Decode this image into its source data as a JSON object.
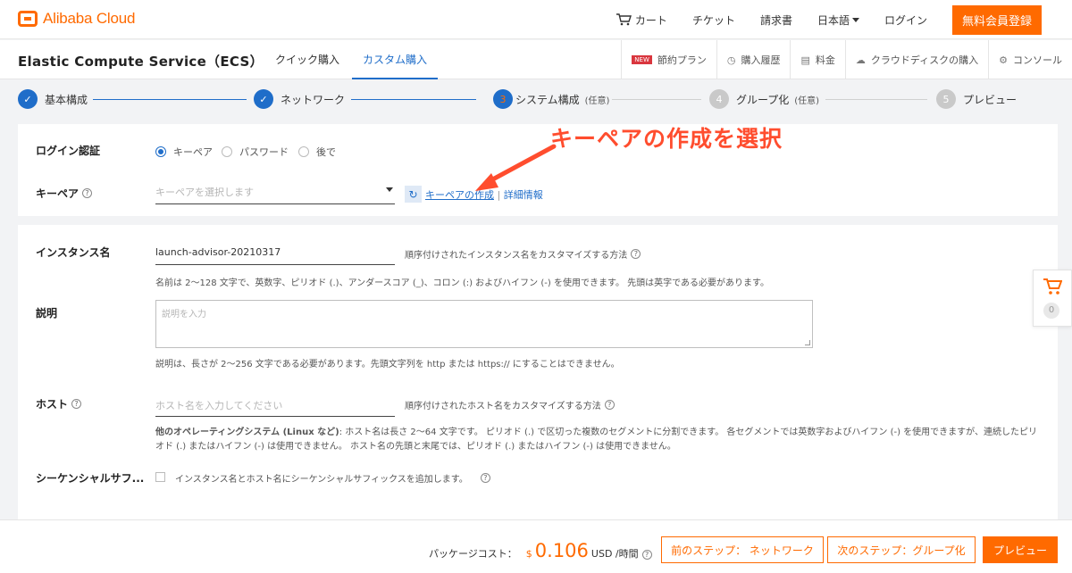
{
  "header": {
    "logo_text": "Alibaba Cloud",
    "nav": {
      "cart": "カート",
      "ticket": "チケット",
      "invoice": "請求書",
      "language": "日本語",
      "login": "ログイン"
    },
    "signup": "無料会員登録"
  },
  "product": {
    "title": "Elastic Compute Service（ECS）",
    "tabs": [
      "クイック購入",
      "カスタム購入"
    ],
    "active_tab": "カスタム購入",
    "links": {
      "new_badge": "NEW",
      "savings": "節約プラン",
      "history": "購入履歴",
      "pricing": "料金",
      "cloud_disk": "クラウドディスクの購入",
      "console": "コンソール"
    }
  },
  "steps": [
    {
      "num": "1",
      "label": "基本構成",
      "state": "done",
      "note": ""
    },
    {
      "num": "2",
      "label": "ネットワーク",
      "state": "done",
      "note": ""
    },
    {
      "num": "3",
      "label": "システム構成",
      "state": "current",
      "note": "(任意)"
    },
    {
      "num": "4",
      "label": "グループ化",
      "state": "todo",
      "note": "(任意)"
    },
    {
      "num": "5",
      "label": "プレビュー",
      "state": "todo",
      "note": ""
    }
  ],
  "login_section": {
    "auth_label": "ログイン認証",
    "options": [
      "キーペア",
      "パスワード",
      "後で"
    ],
    "selected": "キーペア",
    "keypair_label": "キーペア",
    "keypair_placeholder": "キーペアを選択します",
    "create_link": "キーペアの作成",
    "separator": "|",
    "details_link": "詳細情報"
  },
  "annotation": "キーペアの作成を選択",
  "instance_section": {
    "name_label": "インスタンス名",
    "name_value": "launch-advisor-20210317",
    "name_customize": "順序付けされたインスタンス名をカスタマイズする方法",
    "name_hint": "名前は 2～128 文字で、英数字、ピリオド (.)、アンダースコア (_)、コロン (:) およびハイフン (-) を使用できます。 先頭は英字である必要があります。",
    "desc_label": "説明",
    "desc_placeholder": "説明を入力",
    "desc_hint": "説明は、長さが 2～256 文字である必要があります。先頭文字列を http または https:// にすることはできません。",
    "host_label": "ホスト",
    "host_placeholder": "ホスト名を入力してください",
    "host_customize": "順序付けされたホスト名をカスタマイズする方法",
    "host_hint_bold": "他のオペレーティングシステム (Linux など)",
    "host_hint_1": ": ホスト名は長さ 2～64 文字です。 ピリオド (.) で区切った複数のセグメントに分割できます。 各セグメントでは英数字およびハイフン (-) を使用できますが、連続したピリ",
    "host_hint_2": "オド (.) またはハイフン (-) は使用できません。 ホスト名の先頭と末尾では、ピリオド (.) またはハイフン (-) は使用できません。",
    "suffix_label": "シーケンシャルサフ...",
    "suffix_checkbox": "インスタンス名とホスト名にシーケンシャルサフィックスを追加します。"
  },
  "floating_cart": {
    "count": "0"
  },
  "footer": {
    "package_cost_label": "パッケージコスト：",
    "currency_symbol": "$",
    "price": "0.106",
    "price_unit": "USD /時間",
    "prev_button": "前のステップ： ネットワーク",
    "next_button": "次のステップ：グループ化",
    "preview_button": "プレビュー"
  },
  "colors": {
    "accent": "#ff6a00",
    "primary": "#1f6dc9",
    "annotation": "#ff4d2e"
  }
}
